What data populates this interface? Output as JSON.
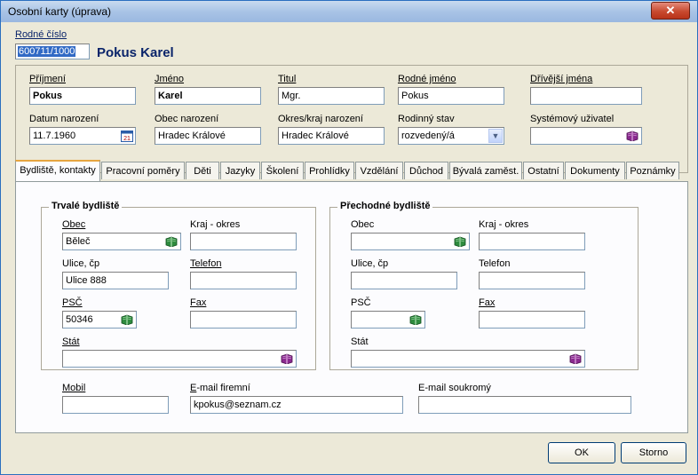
{
  "window": {
    "title": "Osobní karty (úprava)",
    "close_glyph": "✕"
  },
  "header": {
    "rc_label": "Rodné číslo",
    "rc_value": "600711/1000",
    "person_name": "Pokus Karel"
  },
  "fields": {
    "prijmeni": {
      "label": "Příjmení",
      "value": "Pokus"
    },
    "jmeno": {
      "label": "Jméno",
      "value": "Karel"
    },
    "titul": {
      "label": "Titul",
      "value": "Mgr."
    },
    "rodne_jmeno": {
      "label": "Rodné jméno",
      "value": "Pokus"
    },
    "drivejsi_jmena": {
      "label": "Dřívější jména",
      "value": ""
    },
    "datum_narozeni": {
      "label": "Datum narození",
      "value": "11.7.1960"
    },
    "obec_narozeni": {
      "label": "Obec narození",
      "value": "Hradec Králové"
    },
    "okres_narozeni": {
      "label": "Okres/kraj narození",
      "value": "Hradec Králové"
    },
    "rodinny_stav": {
      "label": "Rodinný stav",
      "value": "rozvedený/á"
    },
    "systemovy_uzivatel": {
      "label": "Systémový uživatel",
      "value": ""
    }
  },
  "tabs": [
    {
      "label": "Bydliště, kontakty",
      "active": true
    },
    {
      "label": "Pracovní poměry"
    },
    {
      "label": "Děti"
    },
    {
      "label": "Jazyky"
    },
    {
      "label": "Školení"
    },
    {
      "label": "Prohlídky"
    },
    {
      "label": "Vzdělání"
    },
    {
      "label": "Důchod"
    },
    {
      "label": "Bývalá zaměst."
    },
    {
      "label": "Ostatní"
    },
    {
      "label": "Dokumenty"
    },
    {
      "label": "Poznámky"
    }
  ],
  "trvale": {
    "title": "Trvalé bydliště",
    "obec_label": "Obec",
    "obec": "Běleč",
    "kraj_label": "Kraj - okres",
    "kraj": "",
    "ulice_label": "Ulice, čp",
    "ulice": "Ulice 888",
    "telefon_label": "Telefon",
    "telefon": "",
    "psc_label": "PSČ",
    "psc": "50346",
    "fax_label": "Fax",
    "fax": "",
    "stat_label": "Stát",
    "stat": ""
  },
  "prechodne": {
    "title": "Přechodné bydliště",
    "obec_label": "Obec",
    "obec": "",
    "kraj_label": "Kraj - okres",
    "kraj": "",
    "ulice_label": "Ulice, čp",
    "ulice": "",
    "telefon_label": "Telefon",
    "telefon": "",
    "psc_label": "PSČ",
    "psc": "",
    "fax_label": "Fax",
    "fax": "",
    "stat_label": "Stát",
    "stat": ""
  },
  "contacts": {
    "mobil_label": "Mobil",
    "mobil": "",
    "email_firemni_label": "E-mail firemní",
    "email_firemni": "kpokus@seznam.cz",
    "email_soukromy_label": "E-mail soukromý",
    "email_soukromy": ""
  },
  "buttons": {
    "ok": "OK",
    "storno": "Storno"
  },
  "colors": {
    "green_book": "#2e8b3e",
    "purple_book": "#8a2a8f",
    "title_blue": "#0a246a"
  }
}
